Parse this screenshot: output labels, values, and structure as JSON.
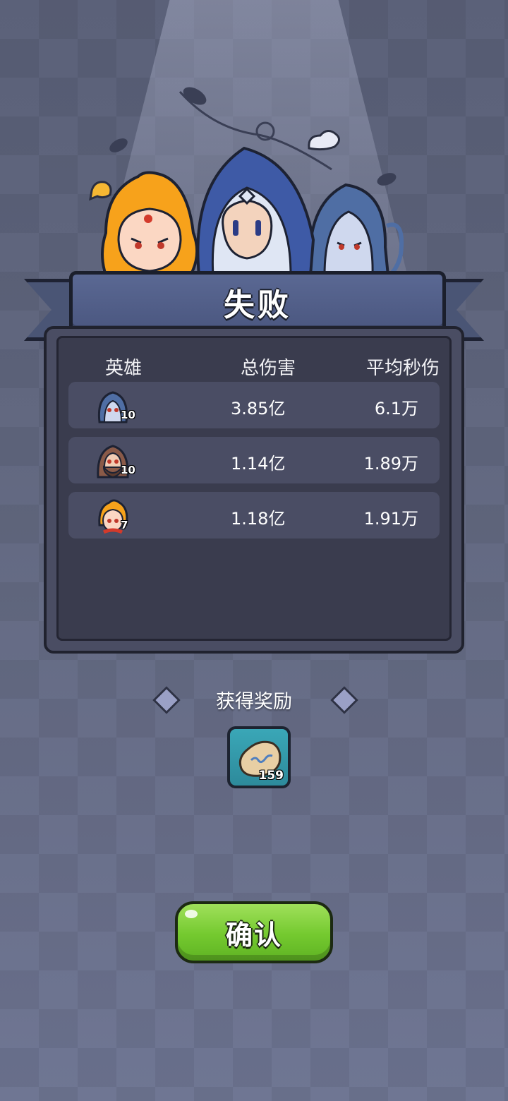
{
  "banner": {
    "title": "失败"
  },
  "stats": {
    "headers": {
      "hero": "英雄",
      "total_damage": "总伤害",
      "avg_dps": "平均秒伤"
    },
    "rows": [
      {
        "hero_icon": "blue-hooded-assassin-icon",
        "level": "10",
        "total_damage": "3.85亿",
        "avg_dps": "6.1万"
      },
      {
        "hero_icon": "brown-hooded-bearded-hero-icon",
        "level": "10",
        "total_damage": "1.14亿",
        "avg_dps": "1.89万"
      },
      {
        "hero_icon": "fire-haired-hero-icon",
        "level": "7",
        "total_damage": "1.18亿",
        "avg_dps": "1.91万"
      }
    ]
  },
  "reward": {
    "title": "获得奖励",
    "items": [
      {
        "icon": "rune-stone-icon",
        "count": "159"
      }
    ]
  },
  "confirm": {
    "label": "确认"
  },
  "colors": {
    "accent_green": "#74c92f",
    "banner_blue": "#4b5780",
    "panel": "#3a3c4e"
  }
}
